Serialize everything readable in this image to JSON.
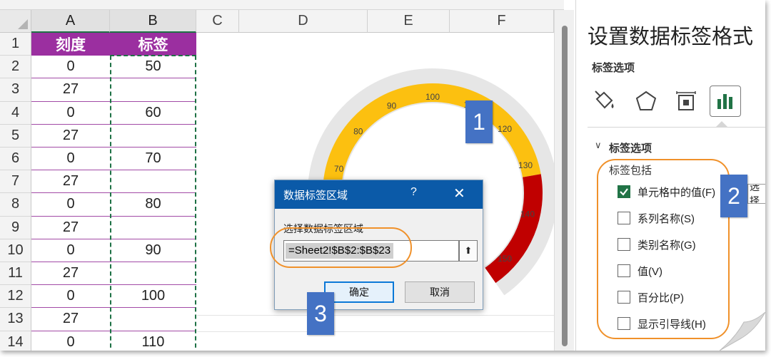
{
  "sheet": {
    "columns": [
      "A",
      "B",
      "C",
      "D",
      "E",
      "F"
    ],
    "rows": [
      "1",
      "2",
      "3",
      "4",
      "5",
      "6",
      "7",
      "8",
      "9",
      "10",
      "11",
      "12",
      "13",
      "14"
    ],
    "header": {
      "a": "刻度",
      "b": "标签"
    },
    "data": [
      {
        "a": "0",
        "b": "50"
      },
      {
        "a": "27",
        "b": ""
      },
      {
        "a": "0",
        "b": "60"
      },
      {
        "a": "27",
        "b": ""
      },
      {
        "a": "0",
        "b": "70"
      },
      {
        "a": "27",
        "b": ""
      },
      {
        "a": "0",
        "b": "80"
      },
      {
        "a": "27",
        "b": ""
      },
      {
        "a": "0",
        "b": "90"
      },
      {
        "a": "27",
        "b": ""
      },
      {
        "a": "0",
        "b": "100"
      },
      {
        "a": "27",
        "b": ""
      },
      {
        "a": "0",
        "b": "110"
      }
    ],
    "header_color": "#9b2fa0",
    "row_line_color": "#a24aa6"
  },
  "gauge": {
    "tick_labels": [
      "70",
      "80",
      "90",
      "100",
      "110",
      "120",
      "130",
      "140",
      "150"
    ],
    "colors": {
      "track": "#e6e6e6",
      "yellow": "#fcc010",
      "red": "#c00000",
      "green": "#4ea72e"
    }
  },
  "dialog": {
    "title": "数据标签区域",
    "help": "?",
    "close": "✕",
    "label": "选择数据标签区域",
    "input_value": "=Sheet2!$B$2:$B$23",
    "collapse_icon": "⬆",
    "ok": "确定",
    "cancel": "取消"
  },
  "callouts": {
    "one": "1",
    "two": "2",
    "three": "3",
    "color": "#4472c4",
    "ring_color": "#f0912a"
  },
  "pane": {
    "title": "设置数据标签格式",
    "subtitle": "标签选项",
    "section": "标签选项",
    "chevron": "∨",
    "include_label": "标签包括",
    "options": [
      {
        "label": "单元格中的值(F)",
        "checked": true
      },
      {
        "label": "系列名称(S)",
        "checked": false
      },
      {
        "label": "类别名称(G)",
        "checked": false
      },
      {
        "label": "值(V)",
        "checked": false
      },
      {
        "label": "百分比(P)",
        "checked": false
      },
      {
        "label": "显示引导线(H)",
        "checked": false
      }
    ],
    "extra_button": "选择",
    "icons": [
      "fill-line-icon",
      "effects-icon",
      "size-properties-icon",
      "label-options-icon"
    ]
  }
}
